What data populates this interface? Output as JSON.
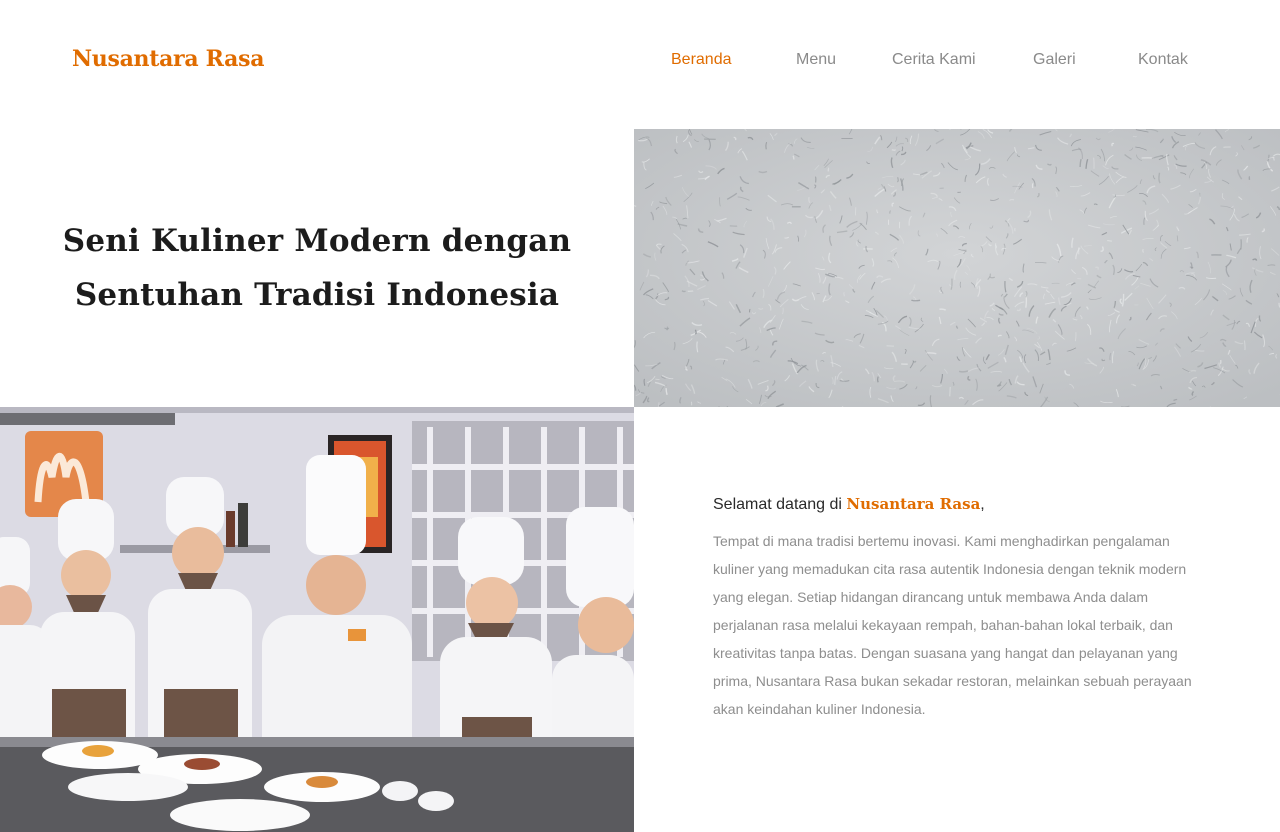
{
  "brand": {
    "name": "Nusantara Rasa",
    "accent_color": "#e06c00"
  },
  "nav": {
    "items": [
      {
        "label": "Beranda",
        "active": true
      },
      {
        "label": "Menu",
        "active": false
      },
      {
        "label": "Cerita Kami",
        "active": false
      },
      {
        "label": "Galeri",
        "active": false
      },
      {
        "label": "Kontak",
        "active": false
      }
    ]
  },
  "hero": {
    "title_line1": "Seni Kuliner Modern dengan",
    "title_line2": "Sentuhan Tradisi Indonesia"
  },
  "welcome": {
    "prefix": "Selamat datang di ",
    "brand": "Nusantara Rasa",
    "suffix": ",",
    "body": "Tempat di mana tradisi bertemu inovasi. Kami menghadirkan pengalaman kuliner yang memadukan cita rasa autentik Indonesia dengan teknik modern yang elegan. Setiap hidangan dirancang untuk membawa Anda dalam perjalanan rasa melalui kekayaan rempah, bahan-bahan lokal terbaik, dan kreativitas tanpa batas. Dengan suasana yang hangat dan pelayanan yang prima, Nusantara Rasa bukan sekadar restoran, melainkan sebuah perayaan akan keindahan kuliner Indonesia."
  },
  "images": {
    "texture": "grey-stucco-wall-texture",
    "photo": "chefs-plating-dishes-photo"
  }
}
